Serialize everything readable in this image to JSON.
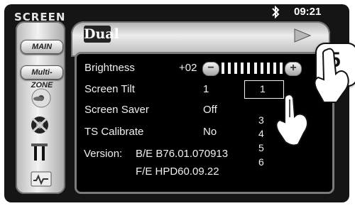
{
  "header": {
    "title": "SCREEN",
    "time": "09:21"
  },
  "brand": {
    "logo": "Dual"
  },
  "sidebar": {
    "items": [
      {
        "label": "MAIN"
      },
      {
        "label": "Multi-ZONE"
      }
    ]
  },
  "settings": {
    "brightness": {
      "label": "Brightness",
      "value": "+02",
      "minus": "−",
      "plus": "+"
    },
    "screen_tilt": {
      "label": "Screen Tilt",
      "value": "1",
      "selected": "1",
      "options": [
        "3",
        "4",
        "5",
        "6"
      ]
    },
    "screen_saver": {
      "label": "Screen Saver",
      "value": "Off"
    },
    "ts_calibrate": {
      "label": "TS Calibrate",
      "value": "No"
    },
    "version": {
      "label": "Version:",
      "be": "B/E B76.01.070913",
      "fe": "F/E HPD60.09.22"
    }
  },
  "step": {
    "number": "5"
  }
}
